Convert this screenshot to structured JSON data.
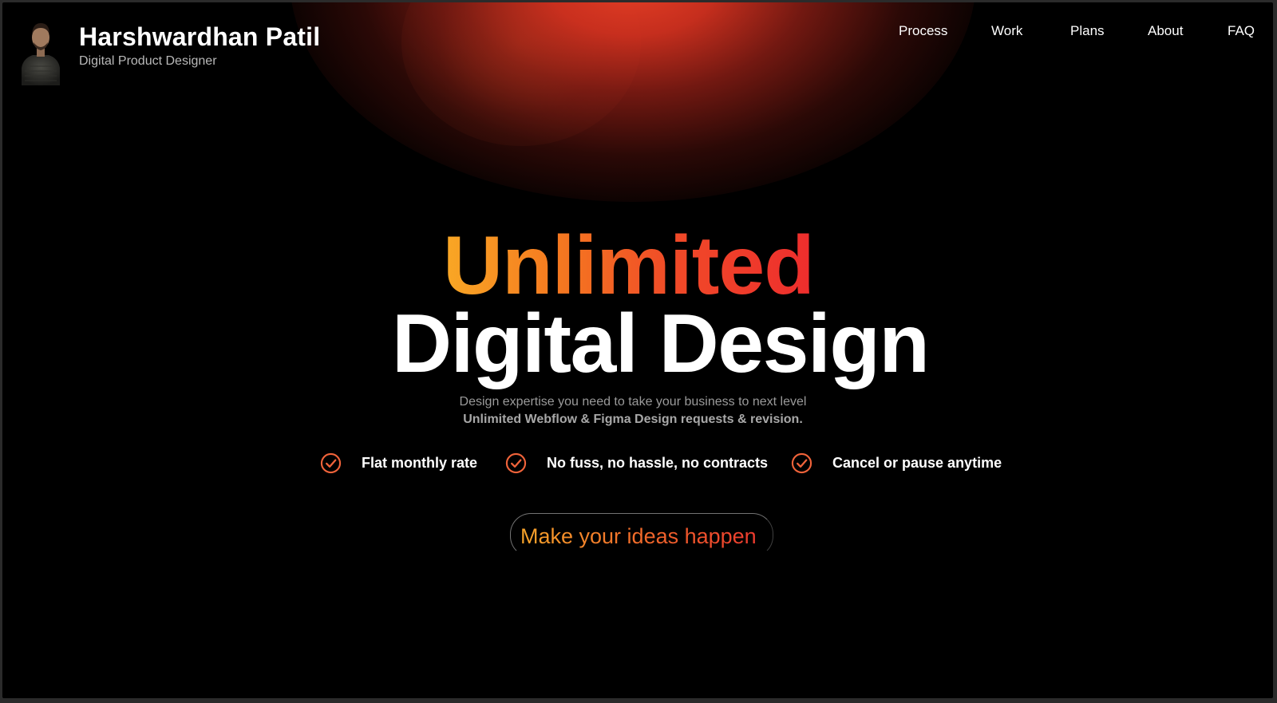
{
  "header": {
    "name": "Harshwardhan Patil",
    "role": "Digital Product Designer",
    "avatar_icon": "avatar-portrait"
  },
  "nav": {
    "items": [
      {
        "label": "Process"
      },
      {
        "label": "Work"
      },
      {
        "label": "Plans"
      },
      {
        "label": "About"
      },
      {
        "label": "FAQ"
      }
    ]
  },
  "hero": {
    "title_highlight": "Unlimited",
    "title_main": "Digital Design",
    "subtitle": "Design expertise you need to take your business to next level",
    "subtitle_strong": "Unlimited Webflow & Figma Design requests & revision.",
    "features": [
      {
        "icon": "check-circle-icon",
        "label": "Flat monthly rate"
      },
      {
        "icon": "check-circle-icon",
        "label": "No fuss, no hassle, no contracts"
      },
      {
        "icon": "check-circle-icon",
        "label": "Cancel or pause anytime"
      }
    ],
    "cta_label": "Make your ideas happen"
  },
  "colors": {
    "background": "#000000",
    "glow": "#e84026",
    "gradient_start": "#f9a825",
    "gradient_end": "#ee2d2d",
    "text": "#ffffff"
  }
}
